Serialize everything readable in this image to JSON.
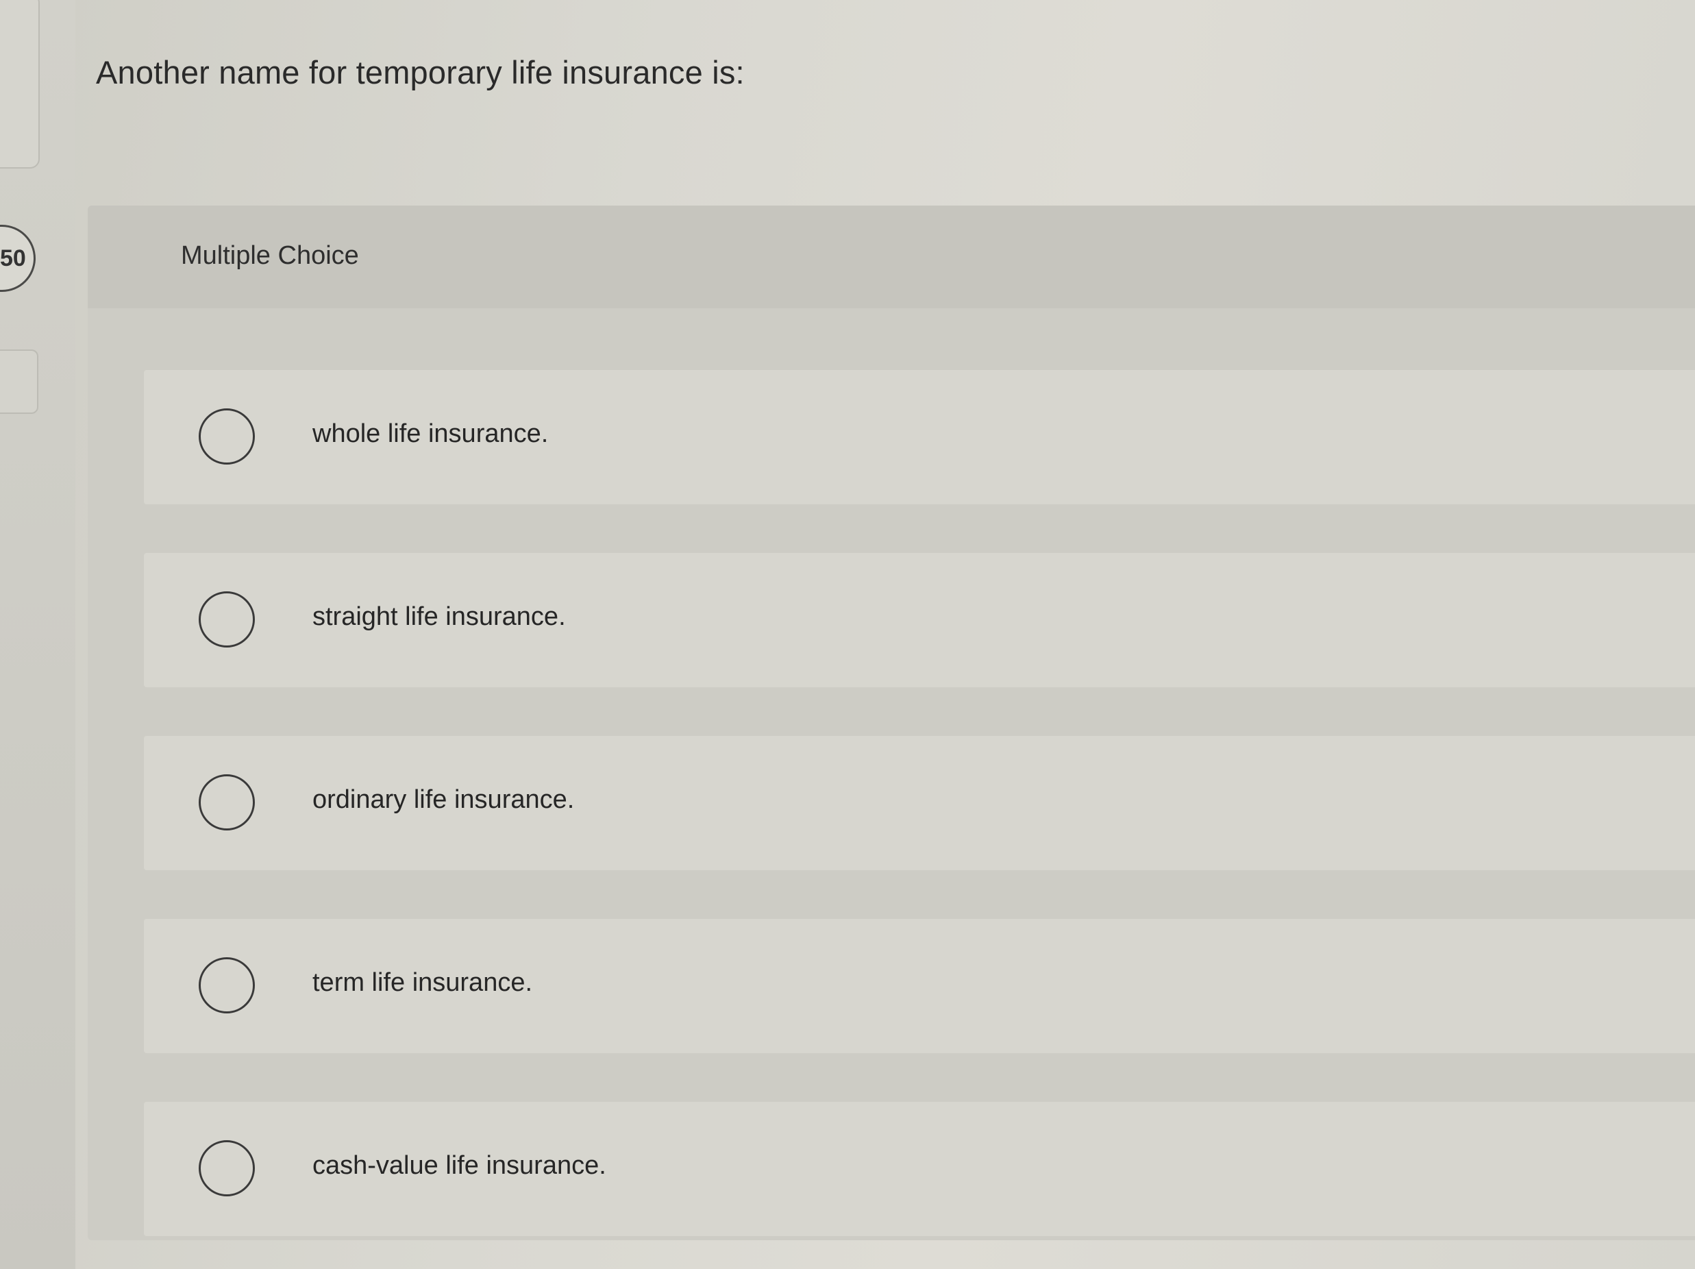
{
  "question": {
    "text": "Another name for temporary life insurance is:",
    "number": "50"
  },
  "answer_section": {
    "type_label": "Multiple Choice",
    "options": [
      {
        "label": "whole life insurance.",
        "selected": false
      },
      {
        "label": "straight life insurance.",
        "selected": false
      },
      {
        "label": "ordinary life insurance.",
        "selected": false
      },
      {
        "label": "term life insurance.",
        "selected": false
      },
      {
        "label": "cash-value life insurance.",
        "selected": false
      }
    ]
  }
}
